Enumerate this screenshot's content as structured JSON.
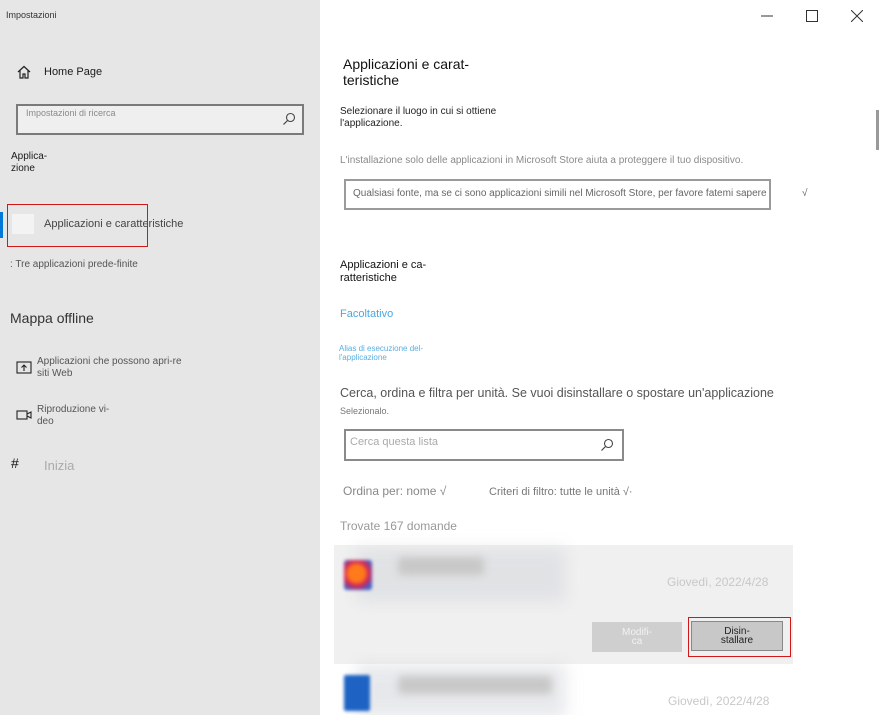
{
  "window": {
    "title": "Impostazioni",
    "controls": {
      "minimize": "minimize-icon",
      "maximize": "maximize-icon",
      "close": "close-icon"
    }
  },
  "sidebar": {
    "home_label": "Home Page",
    "search_placeholder": "Impostazioni di ricerca",
    "section_label": "Applica-zione",
    "items": [
      {
        "label": "Applicazioni e caratteristiche",
        "active": true
      },
      {
        "label": ": Tre applicazioni prede-finite"
      }
    ],
    "offline_label": "Mappa offline",
    "more_items": [
      {
        "label": "Applicazioni che possono apri-re siti Web",
        "icon": "open-web-icon"
      },
      {
        "label": "Riproduzione vi-deo",
        "icon": "video-icon"
      }
    ],
    "startup": {
      "glyph": "#",
      "label": "Inizia"
    },
    "accent_color": "#0078d7",
    "highlight_color": "#d01818"
  },
  "main": {
    "title": "Applicazioni e carat-teristiche",
    "source_label": "Selezionare il luogo in cui si ottiene l'applicazione.",
    "hint": "L'installazione solo delle applicazioni in Microsoft Store aiuta a proteggere il tuo dispositivo.",
    "source_value": "Qualsiasi fonte, ma se ci sono applicazioni simili nel Microsoft Store, per favore fatemi sapere",
    "source_tail": "√",
    "subsection_title": "Applicazioni e ca-ratteristiche",
    "link_optional": "Facoltativo",
    "link_alias": "Alias di esecuzione del-l'applicazione",
    "filter_text": "Cerca, ordina e filtra per unità. Se vuoi disinstallare o spostare un'applicazione",
    "select_text": "Selezionalo.",
    "list_search_placeholder": "Cerca questa lista",
    "sort_label": "Ordina per: nome √",
    "filter_label": "Criteri di filtro: tutte le unità √·",
    "found_label": "Trovate 167 domande",
    "apps": [
      {
        "date": "Giovedì, 2022/4/28",
        "buttons": {
          "modify": "Modifi-ca",
          "uninstall": "Disin-stallare"
        }
      },
      {
        "date": "Giovedì, 2022/4/28"
      }
    ],
    "link_color": "#4aa8e0"
  }
}
